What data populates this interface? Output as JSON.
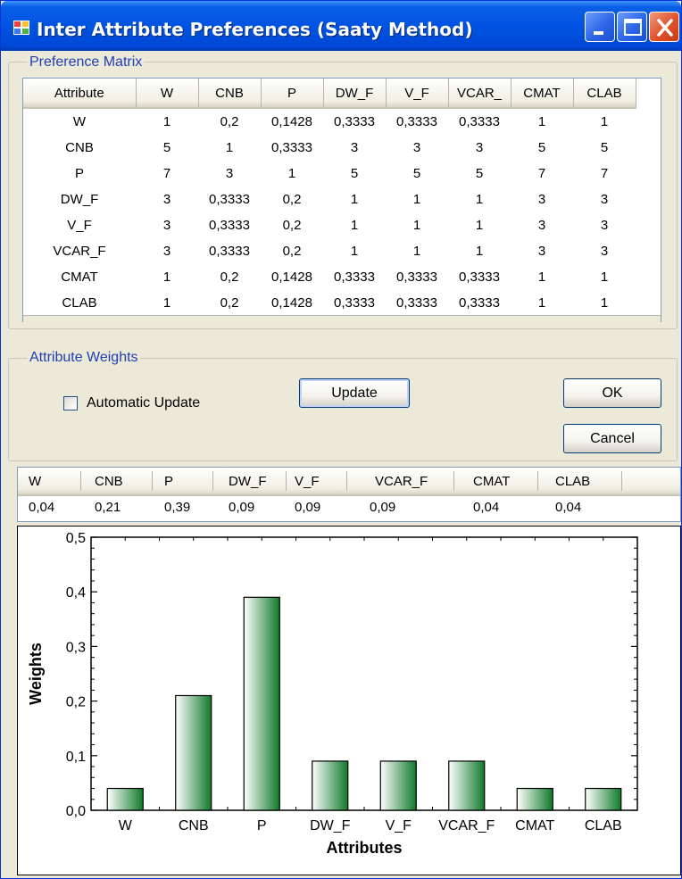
{
  "window": {
    "title": "Inter Attribute Preferences (Saaty Method)"
  },
  "preference_matrix": {
    "group_label": "Preference Matrix",
    "columns": [
      "Attribute",
      "W",
      "CNB",
      "P",
      "DW_F",
      "V_F",
      "VCAR_",
      "CMAT",
      "CLAB"
    ],
    "rows": [
      [
        "W",
        "1",
        "0,2",
        "0,1428",
        "0,3333",
        "0,3333",
        "0,3333",
        "1",
        "1"
      ],
      [
        "CNB",
        "5",
        "1",
        "0,3333",
        "3",
        "3",
        "3",
        "5",
        "5"
      ],
      [
        "P",
        "7",
        "3",
        "1",
        "5",
        "5",
        "5",
        "7",
        "7"
      ],
      [
        "DW_F",
        "3",
        "0,3333",
        "0,2",
        "1",
        "1",
        "1",
        "3",
        "3"
      ],
      [
        "V_F",
        "3",
        "0,3333",
        "0,2",
        "1",
        "1",
        "1",
        "3",
        "3"
      ],
      [
        "VCAR_F",
        "3",
        "0,3333",
        "0,2",
        "1",
        "1",
        "1",
        "3",
        "3"
      ],
      [
        "CMAT",
        "1",
        "0,2",
        "0,1428",
        "0,3333",
        "0,3333",
        "0,3333",
        "1",
        "1"
      ],
      [
        "CLAB",
        "1",
        "0,2",
        "0,1428",
        "0,3333",
        "0,3333",
        "0,3333",
        "1",
        "1"
      ]
    ]
  },
  "attribute_weights": {
    "group_label": "Attribute Weights",
    "automatic_update_label": "Automatic Update",
    "automatic_update_checked": false,
    "update_button": "Update",
    "ok_button": "OK",
    "cancel_button": "Cancel"
  },
  "weights_list": {
    "headers": [
      "W",
      "CNB",
      "P",
      "DW_F",
      "V_F",
      "VCAR_F",
      "CMAT",
      "CLAB"
    ],
    "values": [
      "0,04",
      "0,21",
      "0,39",
      "0,09",
      "0,09",
      "0,09",
      "0,04",
      "0,04"
    ]
  },
  "chart_data": {
    "type": "bar",
    "categories": [
      "W",
      "CNB",
      "P",
      "DW_F",
      "V_F",
      "VCAR_F",
      "CMAT",
      "CLAB"
    ],
    "values": [
      0.04,
      0.21,
      0.39,
      0.09,
      0.09,
      0.09,
      0.04,
      0.04
    ],
    "title": "",
    "xlabel": "Attributes",
    "ylabel": "Weights",
    "ylim": [
      0,
      0.5
    ],
    "yticks": [
      "0,0",
      "0,1",
      "0,2",
      "0,3",
      "0,4",
      "0,5"
    ],
    "bar_color_dark": "#0e7a2a",
    "bar_color_light": "#ffffff",
    "grid": false
  }
}
